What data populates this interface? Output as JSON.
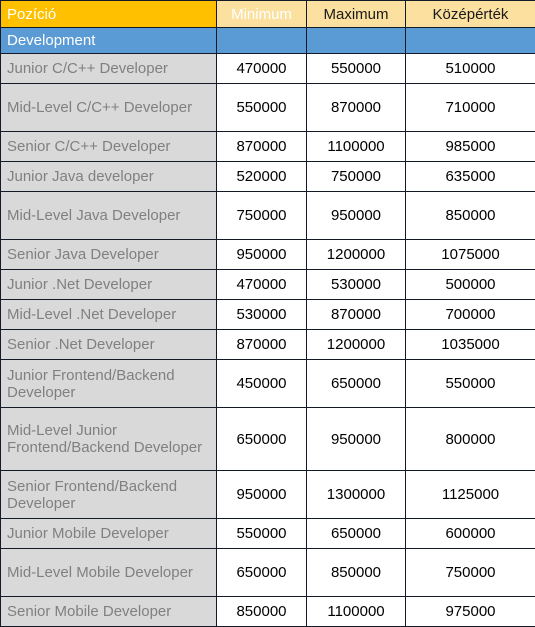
{
  "table": {
    "columns": [
      {
        "key": "position",
        "label": "Pozíció"
      },
      {
        "key": "minimum",
        "label": "Minimum"
      },
      {
        "key": "maximum",
        "label": "Maximum"
      },
      {
        "key": "median",
        "label": "Középérték"
      }
    ],
    "group_label": "Development",
    "colors": {
      "header_position_bg": "#FFC000",
      "header_number_bg": "#FBE0A0",
      "group_row_bg": "#5B9BD5",
      "position_cell_bg": "#D9D9D9",
      "position_cell_text": "#808080",
      "border": "#141A28",
      "number_cell_bg": "#FFFFFF"
    },
    "rows": [
      {
        "position": "Junior C/C++ Developer",
        "minimum": "470000",
        "maximum": "550000",
        "median": "510000",
        "lines": 1
      },
      {
        "position": "Mid-Level C/C++ Developer",
        "minimum": "550000",
        "maximum": "870000",
        "median": "710000",
        "lines": 2
      },
      {
        "position": "Senior C/C++ Developer",
        "minimum": "870000",
        "maximum": "1100000",
        "median": "985000",
        "lines": 1
      },
      {
        "position": "Junior Java developer",
        "minimum": "520000",
        "maximum": "750000",
        "median": "635000",
        "lines": 1
      },
      {
        "position": "Mid-Level Java Developer",
        "minimum": "750000",
        "maximum": "950000",
        "median": "850000",
        "lines": 2
      },
      {
        "position": "Senior Java Developer",
        "minimum": "950000",
        "maximum": "1200000",
        "median": "1075000",
        "lines": 1
      },
      {
        "position": "Junior .Net Developer",
        "minimum": "470000",
        "maximum": "530000",
        "median": "500000",
        "lines": 1
      },
      {
        "position": "Mid-Level .Net Developer",
        "minimum": "530000",
        "maximum": "870000",
        "median": "700000",
        "lines": 1
      },
      {
        "position": "Senior .Net Developer",
        "minimum": "870000",
        "maximum": "1200000",
        "median": "1035000",
        "lines": 1
      },
      {
        "position": "Junior Frontend/Backend Developer",
        "minimum": "450000",
        "maximum": "650000",
        "median": "550000",
        "lines": 2
      },
      {
        "position": "Mid-Level Junior Frontend/Backend Developer",
        "minimum": "650000",
        "maximum": "950000",
        "median": "800000",
        "lines": 3
      },
      {
        "position": "Senior Frontend/Backend Developer",
        "minimum": "950000",
        "maximum": "1300000",
        "median": "1125000",
        "lines": 2
      },
      {
        "position": "Junior Mobile Developer",
        "minimum": "550000",
        "maximum": "650000",
        "median": "600000",
        "lines": 1
      },
      {
        "position": "Mid-Level Mobile Developer",
        "minimum": "650000",
        "maximum": "850000",
        "median": "750000",
        "lines": 2
      },
      {
        "position": "Senior Mobile Developer",
        "minimum": "850000",
        "maximum": "1100000",
        "median": "975000",
        "lines": 1
      }
    ]
  }
}
